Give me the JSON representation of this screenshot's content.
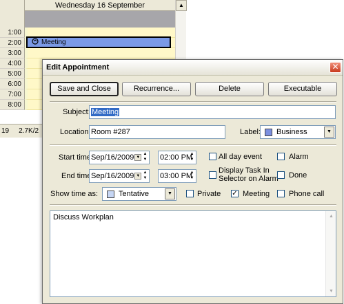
{
  "calendar": {
    "day_header": "Wednesday 16 September",
    "times": [
      "1:00",
      "2:00",
      "3:00",
      "4:00",
      "5:00",
      "6:00",
      "7:00",
      "8:00"
    ],
    "event": {
      "label": "Meeting",
      "icon": "recurring-meeting-icon",
      "color": "#7b9ae6"
    },
    "status": {
      "left": "19",
      "size": "2.7K/2"
    }
  },
  "dialog": {
    "title": "Edit Appointment",
    "buttons": {
      "save_close": "Save and Close",
      "recurrence": "Recurrence...",
      "delete": "Delete",
      "executable": "Executable"
    },
    "subject": {
      "label": "Subject:",
      "value": "Meeting"
    },
    "location": {
      "label": "Location:",
      "value": "Room #287"
    },
    "label_field": {
      "label": "Label:",
      "value": "Business",
      "color": "#7b8fe0"
    },
    "start": {
      "label": "Start time:",
      "date": "Sep/16/2009",
      "time": "02:00 PM"
    },
    "end": {
      "label": "End time:",
      "date": "Sep/16/2009",
      "time": "03:00 PM"
    },
    "show_as": {
      "label": "Show time as:",
      "value": "Tentative",
      "color": "#c6d6f4"
    },
    "checkboxes": {
      "all_day": {
        "label": "All day event",
        "checked": false
      },
      "alarm": {
        "label": "Alarm",
        "checked": false
      },
      "display_task_line1": "Display Task In",
      "display_task_line2": "Selector on Alarm",
      "done": {
        "label": "Done",
        "checked": false
      },
      "private": {
        "label": "Private",
        "checked": false
      },
      "meeting": {
        "label": "Meeting",
        "checked": true
      },
      "phone_call": {
        "label": "Phone call",
        "checked": false
      }
    },
    "notes": "Discuss Workplan"
  }
}
